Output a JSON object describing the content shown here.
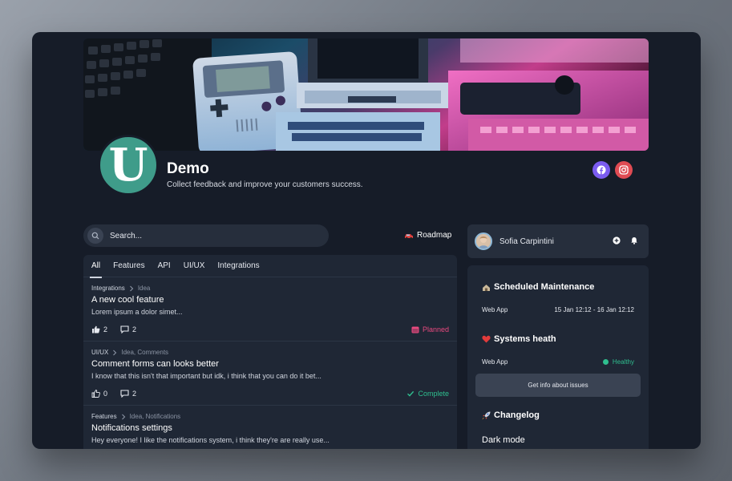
{
  "brand": {
    "logo_letter": "U",
    "name": "Demo",
    "tagline": "Collect feedback and improve your customers success.",
    "social": [
      {
        "icon": "facebook-icon",
        "color": "#7b5cf0"
      },
      {
        "icon": "instagram-icon",
        "color": "#e04b53"
      }
    ]
  },
  "search": {
    "placeholder": "Search..."
  },
  "roadmap": {
    "label": "Roadmap"
  },
  "tabs": [
    "All",
    "Features",
    "API",
    "UI/UX",
    "Integrations"
  ],
  "posts": [
    {
      "category": "Integrations",
      "tags": "Idea",
      "title": "A new cool feature",
      "excerpt": "Lorem ipsum a dolor simet...",
      "likes": "2",
      "comments": "2",
      "status": "Planned",
      "status_color": "#e8497f"
    },
    {
      "category": "UI/UX",
      "tags": "Idea, Comments",
      "title": "Comment forms can looks better",
      "excerpt": "I know that this isn't that important but idk, i think that you can do it bet...",
      "likes": "0",
      "comments": "2",
      "status": "Complete",
      "status_color": "#2fbf8f"
    },
    {
      "category": "Features",
      "tags": "Idea, Notifications",
      "title": "Notifications settings",
      "excerpt": "Hey everyone! I like the notifications system, i think they're are really use..."
    }
  ],
  "user": {
    "name": "Sofia Carpintini"
  },
  "maintenance": {
    "title": "Scheduled Maintenance",
    "app": "Web App",
    "window": "15 Jan 12:12 - 16 Jan 12:12"
  },
  "health": {
    "title": "Systems heath",
    "app": "Web App",
    "status": "Healthy",
    "status_color": "#2fbf8f"
  },
  "issues_button": "Get info about issues",
  "changelog": {
    "title": "Changelog",
    "entry_title": "Dark mode"
  },
  "colors": {
    "accent": "#3f9c8a",
    "window_bg": "#161c28",
    "card_bg": "#1f2735"
  }
}
